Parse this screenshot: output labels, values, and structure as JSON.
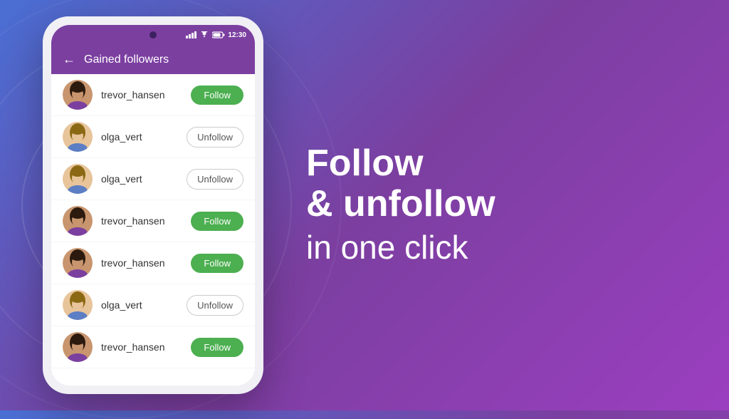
{
  "background": {
    "gradient_start": "#4a6fd4",
    "gradient_end": "#9b3fc0"
  },
  "phone": {
    "status_bar": {
      "time": "12:30"
    },
    "header": {
      "back_label": "←",
      "title": "Gained followers"
    },
    "followers": [
      {
        "id": 1,
        "username": "trevor_hansen",
        "action": "Follow",
        "action_type": "follow",
        "avatar_type": "dark"
      },
      {
        "id": 2,
        "username": "olga_vert",
        "action": "Unfollow",
        "action_type": "unfollow",
        "avatar_type": "light"
      },
      {
        "id": 3,
        "username": "olga_vert",
        "action": "Unfollow",
        "action_type": "unfollow",
        "avatar_type": "light2"
      },
      {
        "id": 4,
        "username": "trevor_hansen",
        "action": "Follow",
        "action_type": "follow",
        "avatar_type": "dark2"
      },
      {
        "id": 5,
        "username": "trevor_hansen",
        "action": "Follow",
        "action_type": "follow",
        "avatar_type": "dark3"
      },
      {
        "id": 6,
        "username": "olga_vert",
        "action": "Unfollow",
        "action_type": "unfollow",
        "avatar_type": "light3"
      },
      {
        "id": 7,
        "username": "trevor_hansen",
        "action": "Follow",
        "action_type": "follow",
        "avatar_type": "dark4"
      }
    ]
  },
  "promo": {
    "line1": "Follow",
    "line2": "& unfollow",
    "line3": "in one click"
  }
}
